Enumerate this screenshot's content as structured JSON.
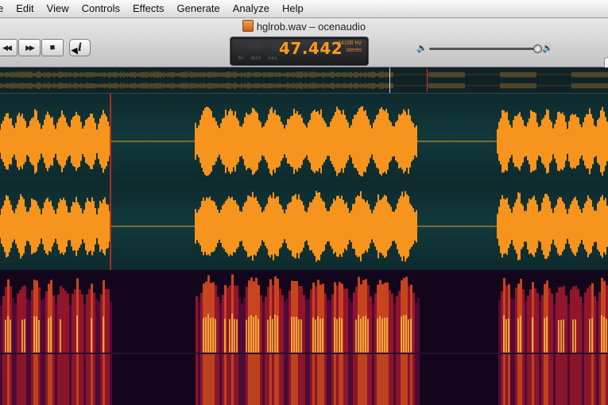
{
  "menubar": {
    "items": [
      "e",
      "Edit",
      "View",
      "Controls",
      "Effects",
      "Generate",
      "Analyze",
      "Help"
    ]
  },
  "window": {
    "title": "hglrob.wav – ocenaudio"
  },
  "transport": {
    "rewind_icon": "◀◀",
    "forward_icon": "▶▶",
    "stop_icon": "■",
    "info_label": "i"
  },
  "time_display": {
    "dim_digits": "-00:00",
    "time": "47.442",
    "units": "hr min sec",
    "sample_rate": "44100 Hz",
    "channels": "stereo"
  },
  "volume": {
    "low_icon": "🔈",
    "high_icon": "🔊",
    "level": 0.95
  },
  "colors": {
    "waveform": "#f7941d",
    "background": "#0e2a2d",
    "playhead": "#c62e1e",
    "accent": "#ff9a1c"
  }
}
